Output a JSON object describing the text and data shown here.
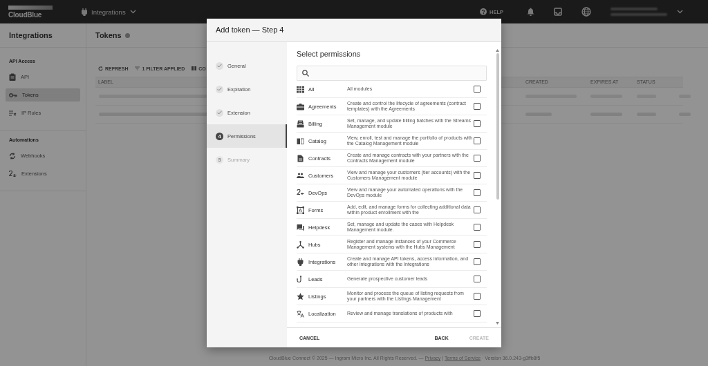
{
  "topbar": {
    "logo": "CloudBlue",
    "module": "Integrations",
    "help": "HELP"
  },
  "sidebar": {
    "title": "Integrations",
    "sections": [
      {
        "heading": "API Access",
        "items": [
          {
            "label": "API",
            "selected": false
          },
          {
            "label": "Tokens",
            "selected": true
          },
          {
            "label": "IP Rules",
            "selected": false
          }
        ]
      },
      {
        "heading": "Automations",
        "items": [
          {
            "label": "Webhooks",
            "selected": false
          },
          {
            "label": "Extensions",
            "selected": false
          }
        ]
      }
    ]
  },
  "page": {
    "title": "Tokens",
    "toolbar": [
      "REFRESH",
      "1 FILTER APPLIED",
      "CO"
    ],
    "columns": [
      "LABEL",
      "CREATED",
      "EXPIRES AT",
      "STATUS"
    ]
  },
  "footer": {
    "text": "CloudBlue Connect © 2025 — Ingram Micro Inc. All Rights Reserved. —",
    "privacy": "Privacy",
    "separator": "|",
    "terms": "Terms of Service",
    "version": "· Version 36.0.243-g3ffb8f5"
  },
  "dialog": {
    "title": "Add token — Step 4",
    "steps": [
      {
        "label": "General",
        "completed": true,
        "selected": false
      },
      {
        "label": "Expiration",
        "completed": true,
        "selected": false
      },
      {
        "label": "Extension",
        "completed": true,
        "selected": false
      },
      {
        "number": "4",
        "label": "Permissions",
        "completed": false,
        "selected": true
      },
      {
        "number": "5",
        "label": "Summary",
        "completed": false,
        "selected": false
      }
    ],
    "heading": "Select permissions",
    "permissions": [
      {
        "name": "All",
        "description": "All modules",
        "checked": false
      },
      {
        "name": "Agreements",
        "description": "Create and control the lifecycle of agreements (contract templates) with the Agreements",
        "checked": false
      },
      {
        "name": "Billing",
        "description": "Set, manage, and update billing batches with the Streams Management module",
        "checked": false
      },
      {
        "name": "Catalog",
        "description": "View, enroll, test and manage the portfolio of products with the Catalog Management module",
        "checked": false
      },
      {
        "name": "Contracts",
        "description": "Create and manage contracts with your partners with the Contracts Management module",
        "checked": false
      },
      {
        "name": "Customers",
        "description": "View and manage your customers (tier accounts) with the Customers Management module",
        "checked": false
      },
      {
        "name": "DevOps",
        "description": "View and manage your automated operations with the DevOps module",
        "checked": false
      },
      {
        "name": "Forms",
        "description": "Add, edit, and manage forms for collecting additional data within product enrollment with the",
        "checked": false
      },
      {
        "name": "Helpdesk",
        "description": "Set, manage and update the cases with Helpdesk Management module.",
        "checked": false
      },
      {
        "name": "Hubs",
        "description": "Register and manage instances of your Commerce Management systems with the Hubs Management",
        "checked": false
      },
      {
        "name": "Integrations",
        "description": "Create and manage API tokens, access information, and other integrations with the Integrations",
        "checked": false
      },
      {
        "name": "Leads",
        "description": "Generate prospective customer leads",
        "checked": false
      },
      {
        "name": "Listings",
        "description": "Monitor and process the queue of listing requests from your partners with the Listings Management",
        "checked": false
      },
      {
        "name": "Localization",
        "description": "Review and manage translations of products with",
        "checked": false
      }
    ],
    "buttons": {
      "cancel": "CANCEL",
      "back": "BACK",
      "create": "CREATE",
      "create_disabled": true
    }
  }
}
